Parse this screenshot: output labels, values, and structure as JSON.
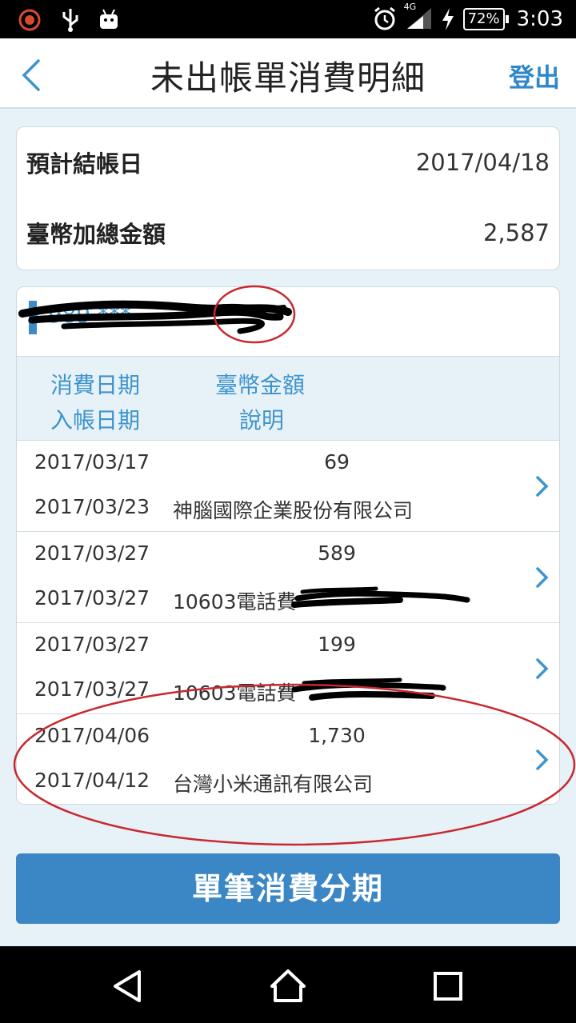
{
  "status_bar": {
    "network": "4G",
    "battery": "72%",
    "time": "3:03"
  },
  "header": {
    "title": "未出帳單消費明細",
    "logout_label": "登出"
  },
  "summary": {
    "close_date_label": "預計結帳日",
    "close_date_value": "2017/04/18",
    "total_label": "臺幣加總金額",
    "total_value": "2,587"
  },
  "card": {
    "number_visible": "3   989    ***"
  },
  "columns": {
    "purchase_date": "消費日期",
    "amount": "臺幣金額",
    "posting_date": "入帳日期",
    "description": "說明"
  },
  "transactions": [
    {
      "purchase_date": "2017/03/17",
      "amount": "69",
      "posting_date": "2017/03/23",
      "description": "神腦國際企業股份有限公司"
    },
    {
      "purchase_date": "2017/03/27",
      "amount": "589",
      "posting_date": "2017/03/27",
      "description": "10603電話費"
    },
    {
      "purchase_date": "2017/03/27",
      "amount": "199",
      "posting_date": "2017/03/27",
      "description": "10603電話費"
    },
    {
      "purchase_date": "2017/04/06",
      "amount": "1,730",
      "posting_date": "2017/04/12",
      "description": "台灣小米通訊有限公司"
    }
  ],
  "install_button_label": "單筆消費分期",
  "colors": {
    "accent": "#3b86c4",
    "link": "#2e87c8",
    "annotation": "#c8282f"
  }
}
